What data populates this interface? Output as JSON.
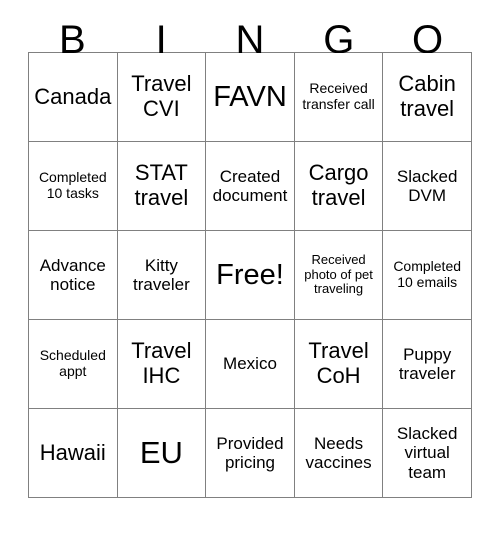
{
  "card": {
    "header": {
      "letters": [
        "B",
        "I",
        "N",
        "G",
        "O"
      ]
    },
    "rows": [
      [
        {
          "text": "Canada",
          "size": "md"
        },
        {
          "text": "Travel CVI",
          "size": "md"
        },
        {
          "text": "FAVN",
          "size": "lg"
        },
        {
          "text": "Received transfer call",
          "size": "xs"
        },
        {
          "text": "Cabin travel",
          "size": "md"
        }
      ],
      [
        {
          "text": "Completed 10 tasks",
          "size": "xs"
        },
        {
          "text": "STAT travel",
          "size": "md"
        },
        {
          "text": "Created document",
          "size": "sm"
        },
        {
          "text": "Cargo travel",
          "size": "md"
        },
        {
          "text": "Slacked DVM",
          "size": "sm"
        }
      ],
      [
        {
          "text": "Advance notice",
          "size": "sm"
        },
        {
          "text": "Kitty traveler",
          "size": "sm"
        },
        {
          "text": "Free!",
          "size": "lg"
        },
        {
          "text": "Received photo of pet traveling",
          "size": "xxs"
        },
        {
          "text": "Completed 10 emails",
          "size": "xs"
        }
      ],
      [
        {
          "text": "Scheduled appt",
          "size": "xs"
        },
        {
          "text": "Travel IHC",
          "size": "md"
        },
        {
          "text": "Mexico",
          "size": "sm"
        },
        {
          "text": "Travel CoH",
          "size": "md"
        },
        {
          "text": "Puppy traveler",
          "size": "sm"
        }
      ],
      [
        {
          "text": "Hawaii",
          "size": "md"
        },
        {
          "text": "EU",
          "size": "xl"
        },
        {
          "text": "Provided pricing",
          "size": "sm"
        },
        {
          "text": "Needs vaccines",
          "size": "sm"
        },
        {
          "text": "Slacked virtual team",
          "size": "sm"
        }
      ]
    ]
  },
  "colors": {
    "border": "#808080",
    "text": "#000000",
    "background": "#ffffff"
  }
}
